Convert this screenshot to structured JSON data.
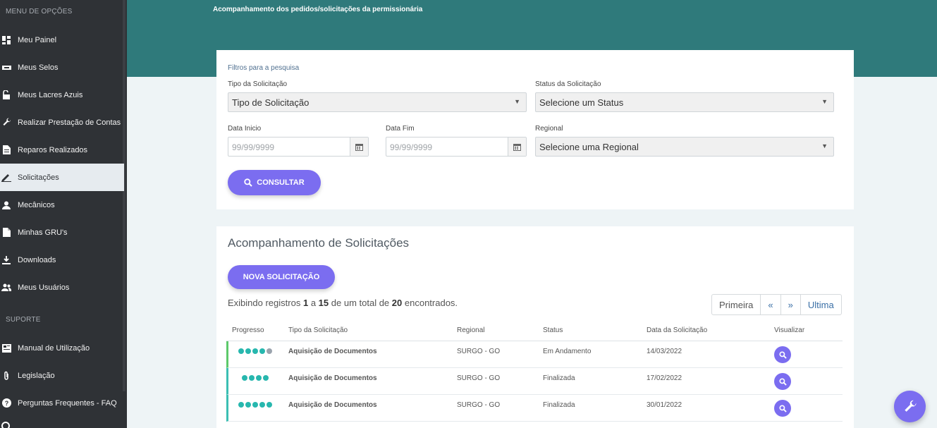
{
  "sidebar": {
    "section_menu": "MENU DE OPÇÕES",
    "section_support": "SUPORTE",
    "items": [
      {
        "label": "Meu Painel",
        "icon": "dashboard-icon"
      },
      {
        "label": "Meus Selos",
        "icon": "ticket-icon"
      },
      {
        "label": "Meus Lacres Azuis",
        "icon": "lock-icon"
      },
      {
        "label": "Realizar Prestação de Contas",
        "icon": "wrench-icon"
      },
      {
        "label": "Reparos Realizados",
        "icon": "file-icon"
      },
      {
        "label": "Solicitações",
        "icon": "pencil-icon"
      },
      {
        "label": "Mecânicos",
        "icon": "user-icon"
      },
      {
        "label": "Minhas GRU's",
        "icon": "document-icon"
      },
      {
        "label": "Downloads",
        "icon": "download-icon"
      },
      {
        "label": "Meus Usuários",
        "icon": "users-icon"
      }
    ],
    "support_items": [
      {
        "label": "Manual de Utilização",
        "icon": "book-icon"
      },
      {
        "label": "Legislação",
        "icon": "paperclip-icon"
      },
      {
        "label": "Perguntas Frequentes - FAQ",
        "icon": "question-icon"
      }
    ]
  },
  "header": {
    "title": "Acompanhamento dos pedidos/solicitações da permissionária"
  },
  "filters": {
    "heading": "Filtros para a pesquisa",
    "tipo_label": "Tipo da Solicitação",
    "tipo_value": "Tipo de Solicitação",
    "status_label": "Status da Solicitação",
    "status_value": "Selecione um Status",
    "data_inicio_label": "Data Inicio",
    "data_inicio_placeholder": "99/99/9999",
    "data_fim_label": "Data Fim",
    "data_fim_placeholder": "99/99/9999",
    "regional_label": "Regional",
    "regional_value": "Selecione uma Regional",
    "consultar_label": "CONSULTAR"
  },
  "results": {
    "title": "Acompanhamento de Solicitações",
    "new_button": "NOVA SOLICITAÇÃO",
    "summary_prefix": "Exibindo registros",
    "summary_from": "1",
    "summary_a": "a",
    "summary_to": "15",
    "summary_mid": "de um total de",
    "summary_total": "20",
    "summary_suffix": "encontrados.",
    "pager": [
      "Primeira",
      "«",
      "»",
      "Ultima"
    ],
    "columns": [
      "Progresso",
      "Tipo da Solicitação",
      "Regional",
      "Status",
      "Data da Solicitação",
      "Visualizar"
    ],
    "rows": [
      {
        "progress_filled": 4,
        "progress_total": 5,
        "tipo": "Aquisição de Documentos",
        "regional": "SURGO - GO",
        "status": "Em Andamento",
        "data": "14/03/2022"
      },
      {
        "progress_filled": 4,
        "progress_total": 4,
        "tipo": "Aquisição de Documentos",
        "regional": "SURGO - GO",
        "status": "Finalizada",
        "data": "17/02/2022"
      },
      {
        "progress_filled": 5,
        "progress_total": 5,
        "tipo": "Aquisição de Documentos",
        "regional": "SURGO - GO",
        "status": "Finalizada",
        "data": "30/01/2022"
      }
    ]
  },
  "colors": {
    "sidebar_bg": "#2f3236",
    "header_bg": "#2f7a7b",
    "accent": "#7b6df0",
    "progress": "#27b7ae"
  }
}
